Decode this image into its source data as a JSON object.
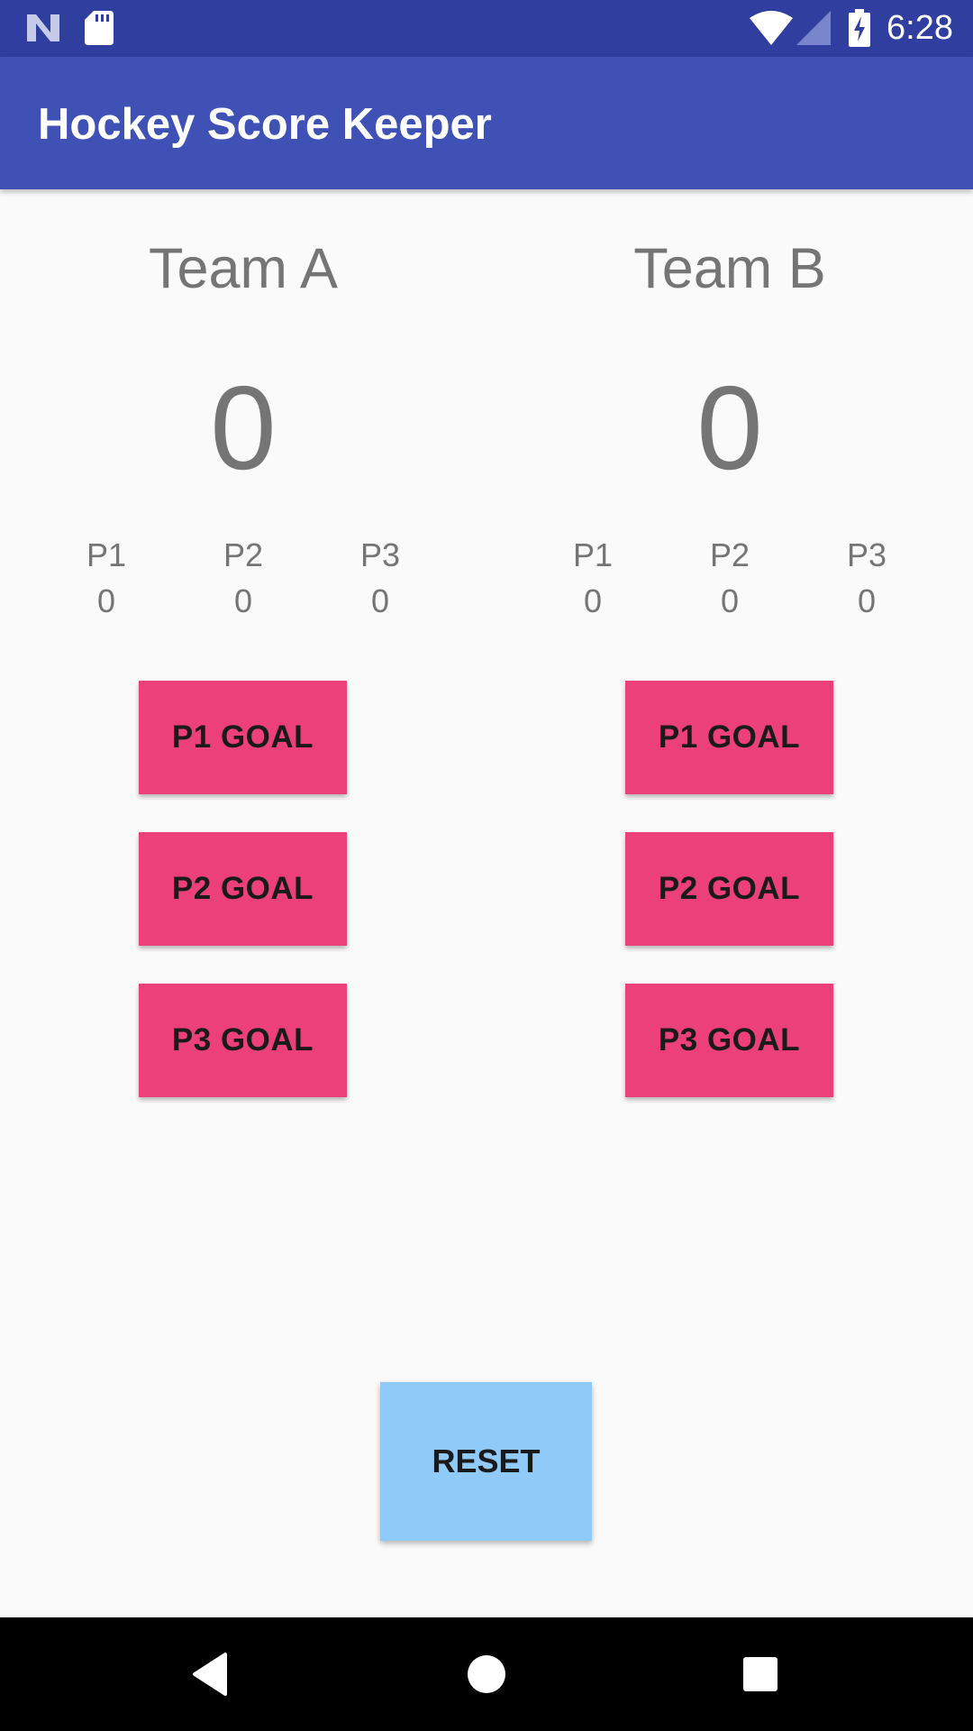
{
  "status_bar": {
    "time": "6:28",
    "icons": [
      "notification-n-icon",
      "sd-card-icon",
      "wifi-icon",
      "cell-signal-icon",
      "battery-charging-icon"
    ]
  },
  "app_bar": {
    "title": "Hockey Score Keeper"
  },
  "teams": [
    {
      "name": "Team A",
      "score": "0",
      "periods": [
        {
          "label": "P1",
          "value": "0"
        },
        {
          "label": "P2",
          "value": "0"
        },
        {
          "label": "P3",
          "value": "0"
        }
      ],
      "buttons": [
        "P1 GOAL",
        "P2 GOAL",
        "P3 GOAL"
      ]
    },
    {
      "name": "Team B",
      "score": "0",
      "periods": [
        {
          "label": "P1",
          "value": "0"
        },
        {
          "label": "P2",
          "value": "0"
        },
        {
          "label": "P3",
          "value": "0"
        }
      ],
      "buttons": [
        "P1 GOAL",
        "P2 GOAL",
        "P3 GOAL"
      ]
    }
  ],
  "reset_label": "RESET",
  "nav_bar": {
    "icons": [
      "back-icon",
      "home-icon",
      "recents-icon"
    ]
  },
  "colors": {
    "status_bar": "#303f9f",
    "app_bar": "#3f51b5",
    "goal_button": "#ec407a",
    "reset_button": "#90caf9",
    "text_gray": "#757575"
  }
}
